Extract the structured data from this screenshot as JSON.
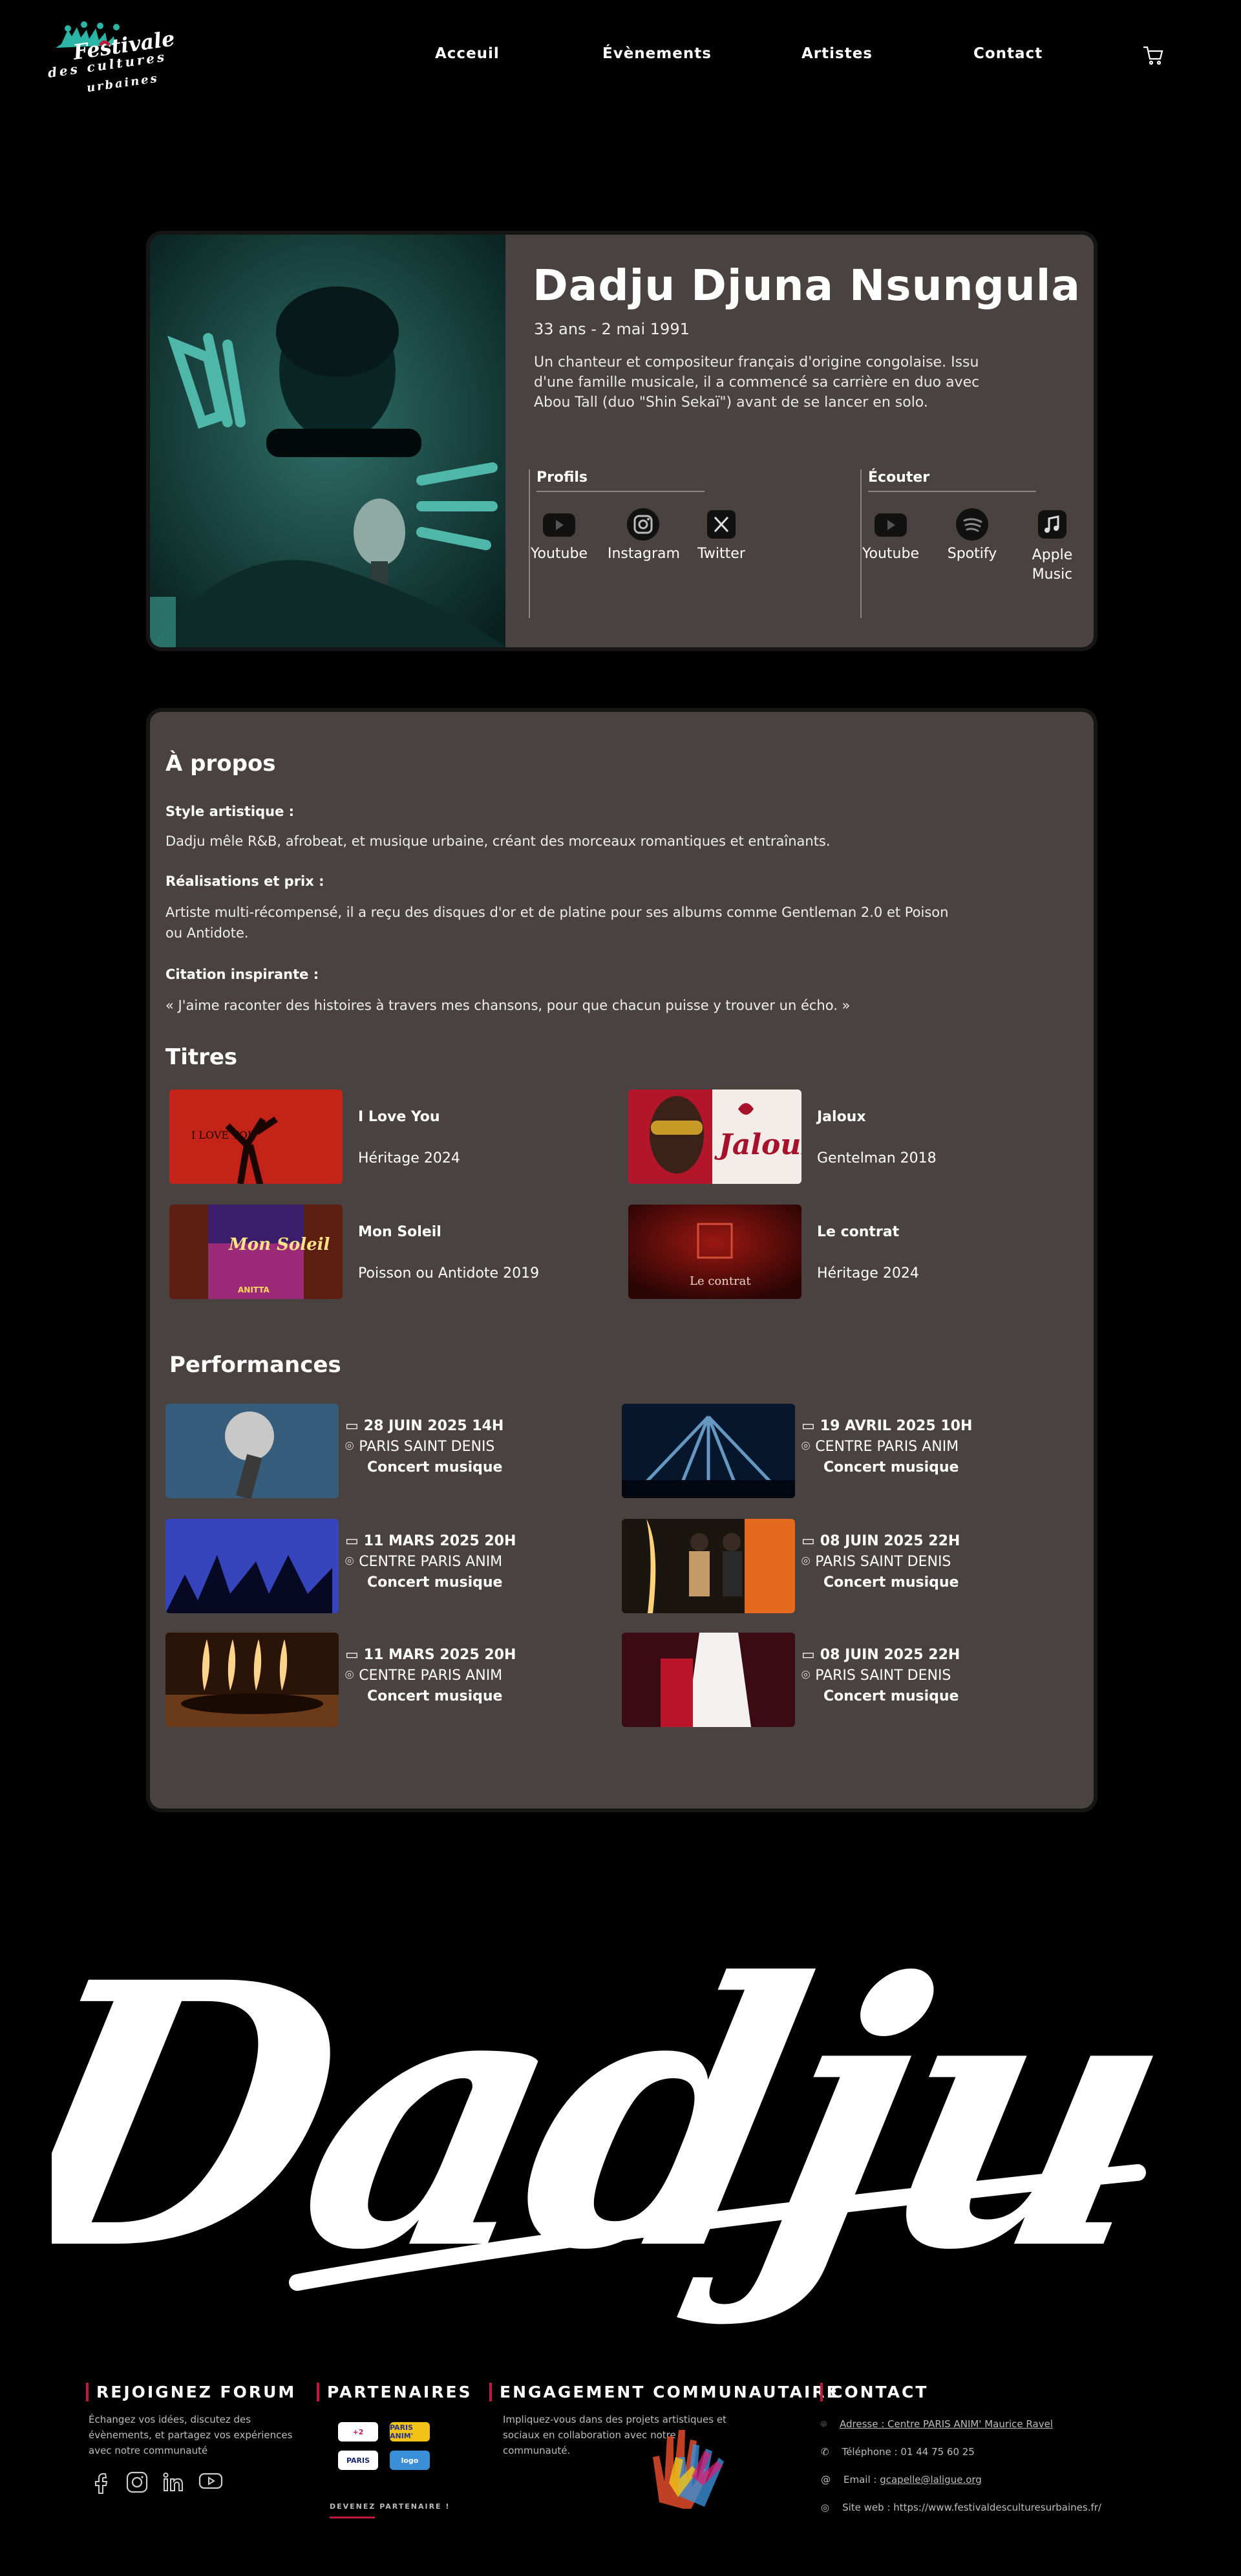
{
  "header": {
    "logo_text": [
      "Festivale",
      "des cultures",
      "urbaines"
    ],
    "nav": [
      "Acceuil",
      "Évènements",
      "Artistes",
      "Contact"
    ]
  },
  "artist": {
    "name": "Dadju Djuna Nsungula",
    "age_birth": "33 ans - 2 mai 1991",
    "bio": "Un chanteur et compositeur français d'origine congolaise. Issu d'une famille musicale, il a commencé sa carrière en duo avec Abou Tall (duo \"Shin Sekaï\") avant de se lancer en solo.",
    "profiles_title": "Profils",
    "profiles": [
      {
        "label": "Youtube",
        "icon": "youtube-icon"
      },
      {
        "label": "Instagram",
        "icon": "instagram-icon"
      },
      {
        "label": "Twitter",
        "icon": "x-icon"
      }
    ],
    "listen_title": "Écouter",
    "listen": [
      {
        "label": "Youtube",
        "icon": "youtube-icon"
      },
      {
        "label": "Spotify",
        "icon": "spotify-icon"
      },
      {
        "label": "Apple Music",
        "icon": "apple-music-icon"
      }
    ]
  },
  "about": {
    "title": "À propos",
    "style_label": "Style artistique :",
    "style_text": "Dadju mêle R&B, afrobeat, et musique urbaine, créant des morceaux romantiques et entraînants.",
    "awards_label": "Réalisations et prix :",
    "awards_text": "Artiste multi-récompensé, il a reçu des disques d'or et de platine pour ses albums comme Gentleman 2.0 et Poison ou Antidote.",
    "quote_label": "Citation inspirante :",
    "quote_text": "« J'aime raconter des histoires à travers mes chansons, pour que chacun puisse y trouver un écho. »"
  },
  "titles": {
    "heading": "Titres",
    "tracks": [
      {
        "name": "I Love You",
        "album": "Héritage 2024",
        "cover_text": "I LOVE YOU"
      },
      {
        "name": "Jaloux",
        "album": "Gentelman 2018",
        "cover_text": "Jaloux"
      },
      {
        "name": "Mon Soleil",
        "album": "Poisson ou Antidote 2019",
        "cover_text": "Mon Soleil"
      },
      {
        "name": "Le contrat",
        "album": "Héritage 2024",
        "cover_text": "Le contrat"
      }
    ]
  },
  "performances": {
    "heading": "Performances",
    "items": [
      {
        "date": "28 JUIN 2025  14H",
        "location": "PARIS SAINT DENIS",
        "type": "Concert musique"
      },
      {
        "date": "19 AVRIL 2025  10H",
        "location": "CENTRE PARIS ANIM",
        "type": "Concert musique"
      },
      {
        "date": "11 MARS 2025  20H",
        "location": "CENTRE PARIS ANIM",
        "type": "Concert musique"
      },
      {
        "date": "08 JUIN 2025  22H",
        "location": "PARIS SAINT DENIS",
        "type": "Concert musique"
      },
      {
        "date": "11 MARS 2025  20H",
        "location": "CENTRE PARIS ANIM",
        "type": "Concert musique"
      },
      {
        "date": "08 JUIN 2025  22H",
        "location": "PARIS SAINT DENIS",
        "type": "Concert musique"
      }
    ]
  },
  "signature_text": "Dadju",
  "footer": {
    "forum_title": "REJOIGNEZ FORUM",
    "forum_text": "Échangez vos idées, discutez des évènements, et partagez vos expériences avec notre communauté",
    "partners_title": "PARTENAIRES",
    "partners": [
      "+2",
      "PARIS ANIM'",
      "PARIS",
      "logo"
    ],
    "partner_cta": "DEVENEZ PARTENAIRE !",
    "engagement_title": "ENGAGEMENT COMMUNAUTAIRE",
    "engagement_text": "Impliquez-vous dans des projets artistiques et sociaux en collaboration avec notre communauté.",
    "contact_title": "CONTACT",
    "contact": {
      "address": "Adresse : Centre PARIS ANIM' Maurice Ravel",
      "phone": "Téléphone : 01 44 75 60 25",
      "email_prefix": "Email : ",
      "email": "gcapelle@laligue.org",
      "site": "Site web : https://www.festivaldesculturesurbaines.fr/"
    }
  },
  "colors": {
    "accent": "#c0173b",
    "panel": "#4a4240",
    "teal": "#2bb5a6"
  }
}
